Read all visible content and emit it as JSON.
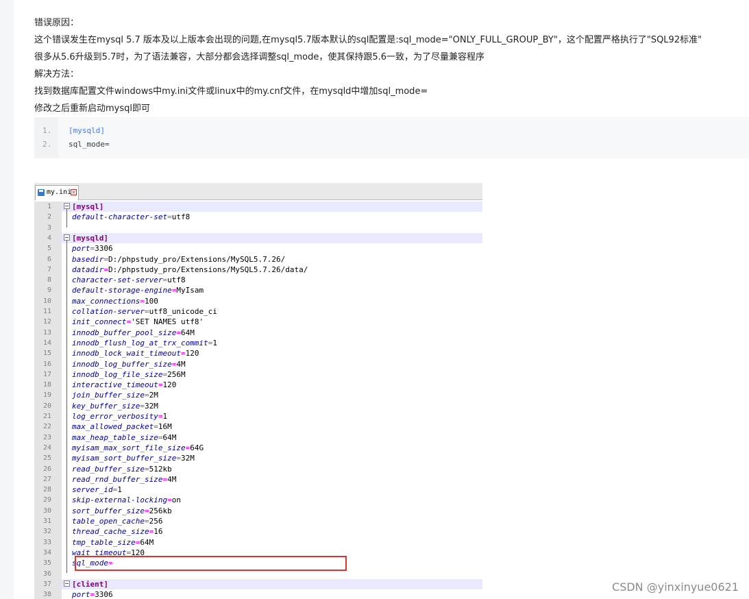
{
  "article": {
    "p1": "错误原因：",
    "p2": "这个错误发生在mysql 5.7 版本及以上版本会出现的问题,在mysql5.7版本默认的sql配置是:sql_mode=\"ONLY_FULL_GROUP_BY\"，这个配置严格执行了\"SQL92标准\"",
    "p3": "很多从5.6升级到5.7时，为了语法兼容，大部分都会选择调整sql_mode，使其保持跟5.6一致，为了尽量兼容程序",
    "p4": "解决方法：",
    "p5": "找到数据库配置文件windows中my.ini文件或linux中的my.cnf文件，在mysqld中增加sql_mode=",
    "p6": "修改之后重新启动mysql即可"
  },
  "codeblock": {
    "lines": [
      {
        "num": "1.",
        "text": "[mysqld]"
      },
      {
        "num": "2.",
        "text": "sql_mode="
      }
    ]
  },
  "screenshot": {
    "tab_name": "my.ini",
    "lines": [
      {
        "n": "1",
        "sect": "[mysql]"
      },
      {
        "n": "2",
        "key": "default-character-set",
        "val": "utf8"
      },
      {
        "n": "3"
      },
      {
        "n": "4",
        "sect": "[mysqld]"
      },
      {
        "n": "5",
        "key": "port",
        "val": "3306"
      },
      {
        "n": "6",
        "key": "basedir",
        "val": "D:/phpstudy_pro/Extensions/MySQL5.7.26/"
      },
      {
        "n": "7",
        "key": "datadir",
        "val": "D:/phpstudy_pro/Extensions/MySQL5.7.26/data/"
      },
      {
        "n": "8",
        "key": "character-set-server",
        "val": "utf8"
      },
      {
        "n": "9",
        "key": "default-storage-engine",
        "val": "MyIsam"
      },
      {
        "n": "10",
        "key": "max_connections",
        "val": "100"
      },
      {
        "n": "11",
        "key": "collation-server",
        "val": "utf8_unicode_ci"
      },
      {
        "n": "12",
        "key": "init_connect",
        "val": "'SET NAMES utf8'"
      },
      {
        "n": "13",
        "key": "innodb_buffer_pool_size",
        "val": "64M"
      },
      {
        "n": "14",
        "key": "innodb_flush_log_at_trx_commit",
        "val": "1"
      },
      {
        "n": "15",
        "key": "innodb_lock_wait_timeout",
        "val": "120"
      },
      {
        "n": "16",
        "key": "innodb_log_buffer_size",
        "val": "4M"
      },
      {
        "n": "17",
        "key": "innodb_log_file_size",
        "val": "256M"
      },
      {
        "n": "18",
        "key": "interactive_timeout",
        "val": "120"
      },
      {
        "n": "19",
        "key": "join_buffer_size",
        "val": "2M"
      },
      {
        "n": "20",
        "key": "key_buffer_size",
        "val": "32M"
      },
      {
        "n": "21",
        "key": "log_error_verbosity",
        "val": "1"
      },
      {
        "n": "22",
        "key": "max_allowed_packet",
        "val": "16M"
      },
      {
        "n": "23",
        "key": "max_heap_table_size",
        "val": "64M"
      },
      {
        "n": "24",
        "key": "myisam_max_sort_file_size",
        "val": "64G"
      },
      {
        "n": "25",
        "key": "myisam_sort_buffer_size",
        "val": "32M"
      },
      {
        "n": "26",
        "key": "read_buffer_size",
        "val": "512kb"
      },
      {
        "n": "27",
        "key": "read_rnd_buffer_size",
        "val": "4M"
      },
      {
        "n": "28",
        "key": "server_id",
        "val": "1"
      },
      {
        "n": "29",
        "key": "skip-external-locking",
        "val": "on"
      },
      {
        "n": "30",
        "key": "sort_buffer_size",
        "val": "256kb"
      },
      {
        "n": "31",
        "key": "table_open_cache",
        "val": "256"
      },
      {
        "n": "32",
        "key": "thread_cache_size",
        "val": "16"
      },
      {
        "n": "33",
        "key": "tmp_table_size",
        "val": "64M"
      },
      {
        "n": "34",
        "key": "wait_timeout",
        "val": "120"
      },
      {
        "n": "35",
        "key": "sql_mode",
        "val": ""
      },
      {
        "n": "36"
      },
      {
        "n": "37",
        "sect": "[client]"
      },
      {
        "n": "38",
        "key": "port",
        "val": "3306"
      }
    ]
  },
  "watermark": "CSDN @yinxinyue0621"
}
